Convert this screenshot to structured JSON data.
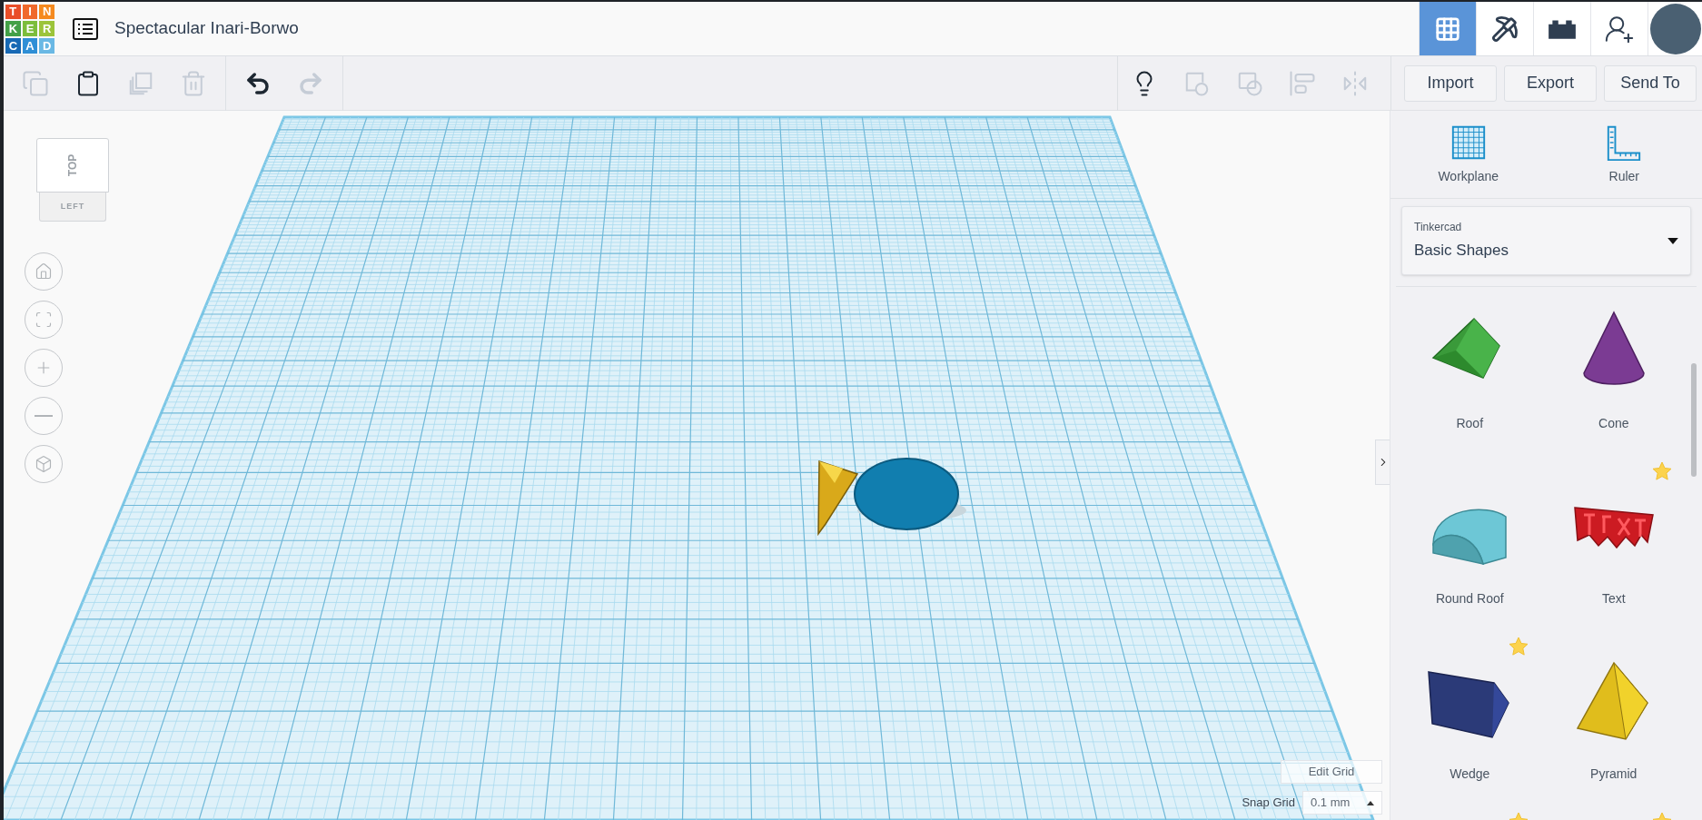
{
  "app": {
    "logo_letters": [
      {
        "text": "T",
        "color": "#e94e28"
      },
      {
        "text": "I",
        "color": "#f0692b"
      },
      {
        "text": "N",
        "color": "#f58a1f"
      },
      {
        "text": "K",
        "color": "#43a047"
      },
      {
        "text": "E",
        "color": "#7cbd3c"
      },
      {
        "text": "R",
        "color": "#9cc43a"
      },
      {
        "text": "C",
        "color": "#1769b5"
      },
      {
        "text": "A",
        "color": "#2f8fd6"
      },
      {
        "text": "D",
        "color": "#6ab8e4"
      }
    ],
    "title": "Spectacular Inari-Borwo"
  },
  "views": [
    {
      "kind": "grid",
      "selected": true
    },
    {
      "kind": "pickaxe",
      "selected": false
    },
    {
      "kind": "bricks",
      "selected": false
    }
  ],
  "toolbar": {
    "edit_tools": [
      {
        "kind": "copy",
        "disabled": true
      },
      {
        "kind": "paste",
        "disabled": false
      },
      {
        "kind": "duplicate",
        "disabled": true
      },
      {
        "kind": "delete",
        "disabled": true
      }
    ],
    "history": [
      {
        "kind": "undo",
        "disabled": false
      },
      {
        "kind": "redo",
        "disabled": true
      }
    ],
    "shape_tools": [
      {
        "kind": "notes",
        "disabled": false
      },
      {
        "kind": "group",
        "disabled": true
      },
      {
        "kind": "ungroup",
        "disabled": true
      },
      {
        "kind": "align",
        "disabled": true
      },
      {
        "kind": "mirror",
        "disabled": true
      }
    ],
    "buttons": [
      "Import",
      "Export",
      "Send To"
    ]
  },
  "view_cube": {
    "top": "TOP",
    "left": "LEFT"
  },
  "nav_controls": [
    {
      "kind": "home"
    },
    {
      "kind": "fit"
    },
    {
      "kind": "zoom_in"
    },
    {
      "kind": "zoom_out"
    },
    {
      "kind": "perspective"
    }
  ],
  "panel": {
    "tools": [
      {
        "kind": "workplane",
        "label": "Workplane"
      },
      {
        "kind": "ruler",
        "label": "Ruler"
      }
    ],
    "library": {
      "source": "Tinkercad",
      "value": "Basic Shapes"
    },
    "shapes": [
      {
        "kind": "roof",
        "label": "Roof",
        "starred": false
      },
      {
        "kind": "cone",
        "label": "Cone",
        "starred": false
      },
      {
        "kind": "round_roof",
        "label": "Round Roof",
        "starred": false
      },
      {
        "kind": "text",
        "label": "Text",
        "starred": true
      },
      {
        "kind": "wedge",
        "label": "Wedge",
        "starred": true
      },
      {
        "kind": "pyramid",
        "label": "Pyramid",
        "starred": false
      },
      {
        "kind": "hidden",
        "starred": true
      },
      {
        "kind": "polygon",
        "starred": true
      }
    ]
  },
  "grid_controls": {
    "edit": "Edit Grid",
    "snap_label": "Snap Grid",
    "snap_value": "0.1 mm"
  }
}
